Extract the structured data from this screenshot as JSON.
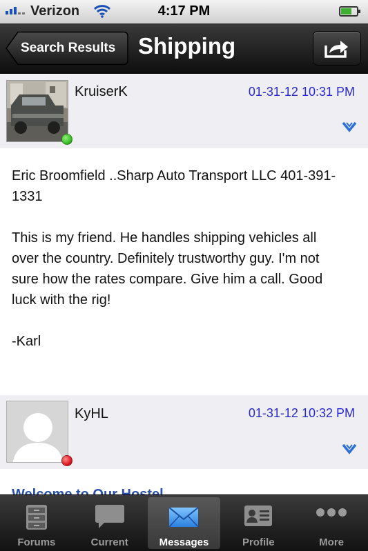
{
  "status_bar": {
    "carrier": "Verizon",
    "time": "4:17 PM"
  },
  "nav": {
    "back_label": "Search Results",
    "title": "Shipping"
  },
  "posts": [
    {
      "author": "KruiserK",
      "date": "01-31-12 10:31 PM",
      "online": true,
      "paragraphs": [
        "Eric Broomfield ..Sharp Auto Transport LLC 401-391-1331",
        "This is my friend.  He handles shipping vehicles all over the country. Definitely trustworthy guy.  I'm not sure how the rates compare. Give him a call. Good luck with the rig!",
        "-Karl"
      ]
    },
    {
      "author": "KyHL",
      "date": "01-31-12 10:32 PM",
      "online": false
    }
  ],
  "next_preview": "Welcome to Our Hostel",
  "tabs": [
    {
      "label": "Forums",
      "icon": "cabinet-icon"
    },
    {
      "label": "Current",
      "icon": "speech-bubble-icon"
    },
    {
      "label": "Messages",
      "icon": "envelope-icon",
      "active": true
    },
    {
      "label": "Profile",
      "icon": "id-card-icon"
    },
    {
      "label": "More",
      "icon": "ellipsis-icon"
    }
  ],
  "colors": {
    "online": "#3fbf2a",
    "offline": "#e01b24",
    "date": "#2a2ad0",
    "chevron": "#2c6fd6"
  }
}
